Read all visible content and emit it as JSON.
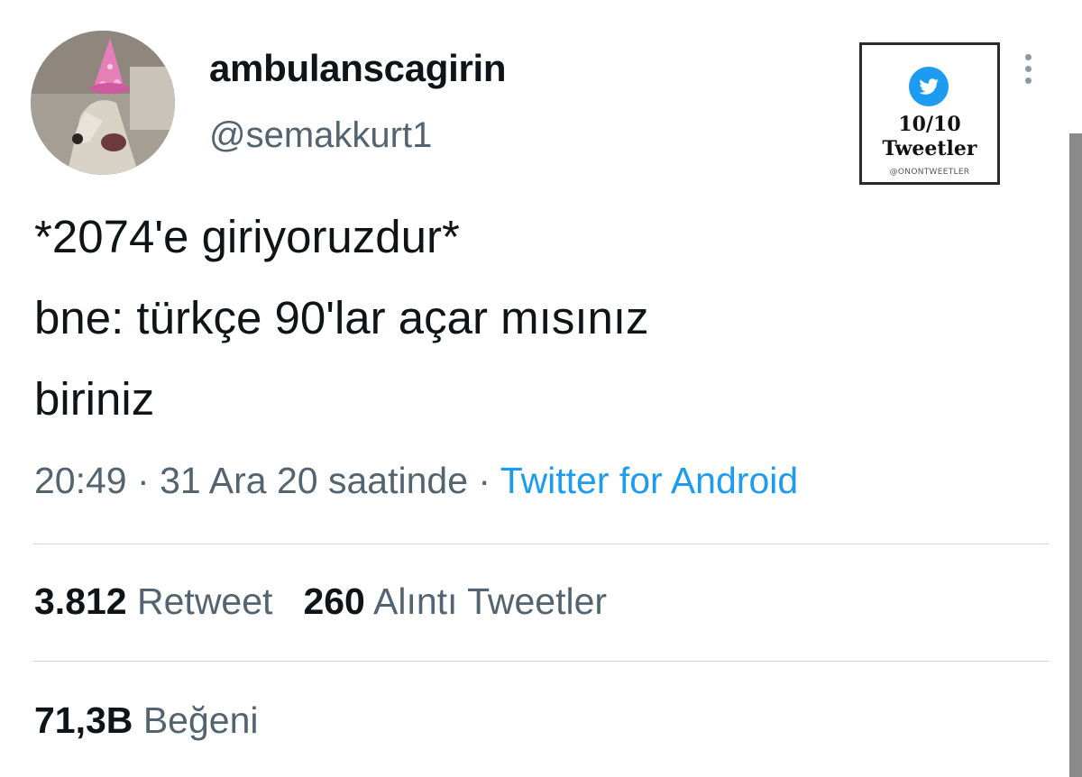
{
  "author": {
    "display_name": "ambulanscagirin",
    "handle": "@semakkurt1"
  },
  "watermark": {
    "score": "10/10",
    "label": "Tweetler",
    "handle": "@ONONTWEETLER",
    "icon": "twitter-bird-icon"
  },
  "tweet": {
    "lines": [
      "*2074'e giriyoruzdur*",
      "bne: türkçe 90'lar açar mısınız",
      "biriniz"
    ],
    "time": "20:49",
    "date": "31 Ara 20 saatinde",
    "separator": "·",
    "source": "Twitter for Android"
  },
  "stats": {
    "retweets_count": "3.812",
    "retweets_label": "Retweet",
    "quotes_count": "260",
    "quotes_label": "Alıntı Tweetler",
    "likes_count": "71,3B",
    "likes_label": "Beğeni"
  },
  "colors": {
    "accent": "#1d9bf0",
    "secondary_text": "#536471",
    "primary_text": "#0f1419"
  }
}
